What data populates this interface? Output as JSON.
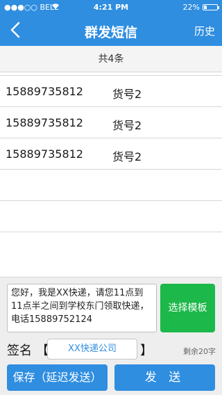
{
  "status_bar": {
    "carrier": "●●●○○ BELL",
    "wifi_icon": "wifi-icon",
    "time": "4:21 PM",
    "battery_percent": "22%",
    "battery_level": 0.22
  },
  "nav": {
    "back_icon": "back-chevron-icon",
    "title": "群发短信",
    "history_label": "历史"
  },
  "summary": {
    "count_text": "共4条"
  },
  "recipients": [
    {
      "phone": "15889735812",
      "goods": "货号2"
    },
    {
      "phone": "15889735812",
      "goods": "货号2"
    },
    {
      "phone": "15889735812",
      "goods": "货号2"
    }
  ],
  "compose": {
    "message": "您好，我是XX快递，请您11点到11点半之间到学校东门领取快递，电话15889752124",
    "template_button": "选择模板",
    "signature_label": "签名",
    "signature_open": "【",
    "signature_value": "XX快递公司",
    "signature_close": "】",
    "remaining": "剩余20字",
    "save_button": "保存（延迟发送）",
    "send_button": "发 送"
  },
  "colors": {
    "primary": "#2f8ee0",
    "template_green": "#1cb84a"
  }
}
